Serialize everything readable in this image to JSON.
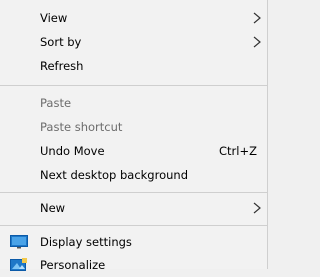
{
  "menu": {
    "items": [
      {
        "label": "View",
        "has_submenu": true
      },
      {
        "label": "Sort by",
        "has_submenu": true
      },
      {
        "label": "Refresh"
      },
      {
        "label": "Paste",
        "disabled": true
      },
      {
        "label": "Paste shortcut",
        "disabled": true
      },
      {
        "label": "Undo Move",
        "shortcut": "Ctrl+Z"
      },
      {
        "label": "Next desktop background"
      },
      {
        "label": "New",
        "has_submenu": true
      },
      {
        "label": "Display settings",
        "icon": "display-icon"
      },
      {
        "label": "Personalize",
        "icon": "personalize-icon"
      }
    ]
  },
  "colors": {
    "menu_background": "#f2f2f2",
    "separator": "#cfcfcf",
    "disabled_text": "#6d6d6d",
    "icon_blue": "#1e78c8"
  }
}
